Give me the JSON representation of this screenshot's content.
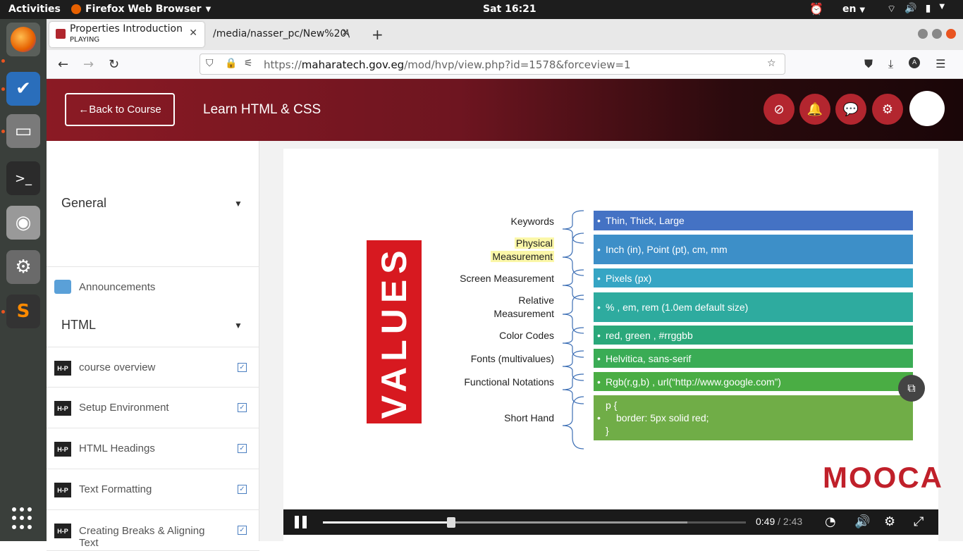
{
  "system": {
    "activities": "Activities",
    "app_name": "Firefox Web Browser",
    "clock": "Sat 16:21",
    "lang": "en"
  },
  "browser": {
    "tabs": [
      {
        "title": "Properties Introduction",
        "subtitle": "PLAYING"
      },
      {
        "title": "/media/nasser_pc/New%20\\"
      }
    ],
    "url_prefix": "https://",
    "url_domain": "maharatech.gov.eg",
    "url_path": "/mod/hvp/view.php?id=1578&forceview=1"
  },
  "header": {
    "back_label": "Back to Course",
    "course_title": "Learn HTML & CSS"
  },
  "sidebar": {
    "general_label": "General",
    "announcements_label": "Announcements",
    "html_label": "HTML",
    "items": [
      {
        "label": "course overview",
        "badge": "H-P"
      },
      {
        "label": "Setup Environment",
        "badge": "H-P"
      },
      {
        "label": "HTML Headings",
        "badge": "H-P"
      },
      {
        "label": "Text Formatting",
        "badge": "H-P"
      },
      {
        "label": "Creating Breaks & Aligning Text",
        "badge": "H-P"
      }
    ]
  },
  "slide": {
    "big_label": "VALUES",
    "rows": [
      {
        "label": "Keywords",
        "value": "Thin, Thick, Large",
        "color": "#4472c4"
      },
      {
        "label_1": "Physical",
        "label_2": "Measurement",
        "value": "Inch (in), Point (pt), cm, mm",
        "color": "#3d8fc8"
      },
      {
        "label": "Screen Measurement",
        "value": "Pixels (px)",
        "color": "#36a5c4"
      },
      {
        "label_1": "Relative",
        "label_2": "Measurement",
        "value": "% , em, rem (1.0em default size)",
        "color": "#2eab9f"
      },
      {
        "label": "Color Codes",
        "value": "red, green , #rrggbb",
        "color": "#2aa87a"
      },
      {
        "label": "Fonts (multivalues)",
        "value": "Helvitica, sans-serif",
        "color": "#3aac55"
      },
      {
        "label": "Functional Notations",
        "value": "Rgb(r,g,b) , url(“http://www.google.com”)",
        "color": "#4aad44"
      },
      {
        "label": "Short Hand",
        "value_1": "p {",
        "value_2": "border: 5px solid red;",
        "value_3": "}",
        "color": "#70ad47"
      }
    ],
    "logo_text": "MOOCA"
  },
  "player": {
    "time_current": "0:49",
    "time_total": "2:43",
    "progress": 0.3
  }
}
